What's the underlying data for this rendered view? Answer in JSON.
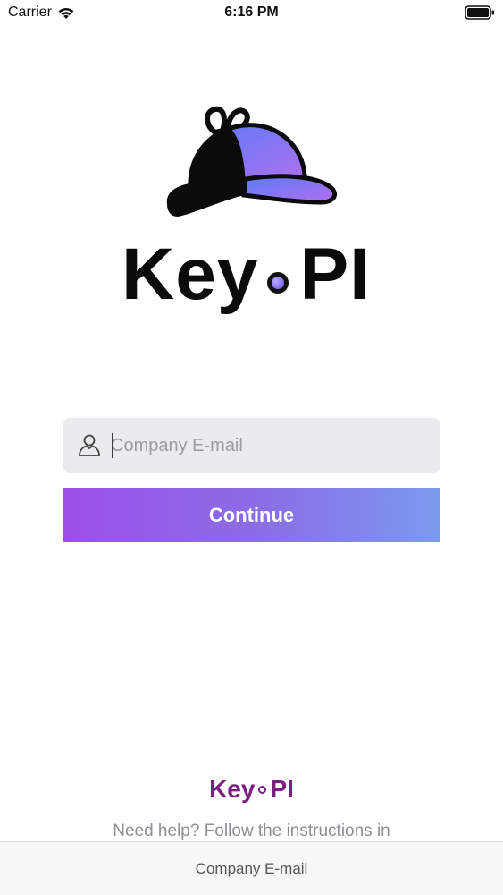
{
  "status_bar": {
    "carrier": "Carrier",
    "time": "6:16 PM",
    "icons": [
      "wifi-icon",
      "battery-icon"
    ]
  },
  "logo": {
    "brand_left": "Key",
    "brand_right": "PI",
    "icon": "detective-hat-icon",
    "colors": {
      "gradient_start": "#5a7bf5",
      "gradient_end": "#b36ff0",
      "ink": "#0b0b0b"
    }
  },
  "form": {
    "email_placeholder": "Company E-mail",
    "email_value": "",
    "email_icon": "user-icon",
    "continue_label": "Continue",
    "button_colors": {
      "start": "#9b4fe8",
      "end": "#7a9bf0"
    }
  },
  "footer": {
    "brand_left": "Key",
    "brand_right": "PI",
    "brand_color": "#7a1f80",
    "help_text": "Need help? Follow the instructions in"
  },
  "bottom_bar": {
    "label": "Company E-mail"
  }
}
